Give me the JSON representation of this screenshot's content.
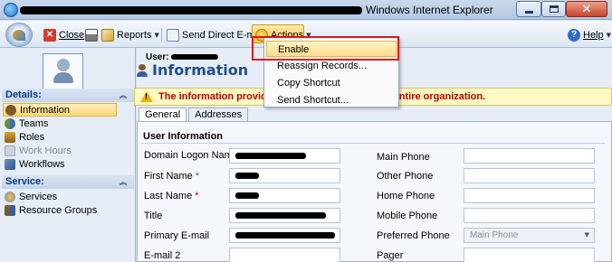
{
  "window": {
    "title": "Windows Internet Explorer"
  },
  "toolbar": {
    "close_label": "Close",
    "reports_label": "Reports",
    "send_email_label": "Send Direct E-mail",
    "actions_label": "Actions",
    "help_label": "Help"
  },
  "actions_menu": {
    "items": [
      "Enable",
      "Reassign Records...",
      "Copy Shortcut",
      "Send Shortcut..."
    ],
    "highlighted": "Enable"
  },
  "nav": {
    "details_header": "Details:",
    "details_items": [
      {
        "label": "Information",
        "selected": true,
        "enabled": true,
        "icon": "person-icon"
      },
      {
        "label": "Teams",
        "selected": false,
        "enabled": true,
        "icon": "team-icon"
      },
      {
        "label": "Roles",
        "selected": false,
        "enabled": true,
        "icon": "roles-icon"
      },
      {
        "label": "Work Hours",
        "selected": false,
        "enabled": false,
        "icon": "calendar-icon"
      },
      {
        "label": "Workflows",
        "selected": false,
        "enabled": true,
        "icon": "workflow-icon"
      }
    ],
    "service_header": "Service:",
    "service_items": [
      {
        "label": "Services",
        "icon": "services-icon"
      },
      {
        "label": "Resource Groups",
        "icon": "resource-groups-icon"
      }
    ]
  },
  "form": {
    "user_label": "User:",
    "title": "Information",
    "warning_prefix": "The information provid",
    "warning_suffix": "ntire organization.",
    "tabs": [
      "General",
      "Addresses"
    ],
    "section_title": "User Information",
    "left_fields": [
      {
        "label": "Domain Logon Name",
        "marker": "*"
      },
      {
        "label": "First Name",
        "marker": "*"
      },
      {
        "label": "Last Name",
        "marker": "*"
      },
      {
        "label": "Title",
        "marker": ""
      },
      {
        "label": "Primary E-mail",
        "marker": ""
      },
      {
        "label": "E-mail 2",
        "marker": ""
      }
    ],
    "right_fields": [
      {
        "label": "Main Phone"
      },
      {
        "label": "Other Phone"
      },
      {
        "label": "Home Phone"
      },
      {
        "label": "Mobile Phone"
      },
      {
        "label": "Preferred Phone",
        "value": "Main Phone"
      },
      {
        "label": "Pager"
      }
    ]
  },
  "colors": {
    "accent_blue": "#214e8c",
    "warning_red": "#c00000",
    "highlight_red": "#e1121f",
    "menu_highlight": "#fcdc8a"
  }
}
